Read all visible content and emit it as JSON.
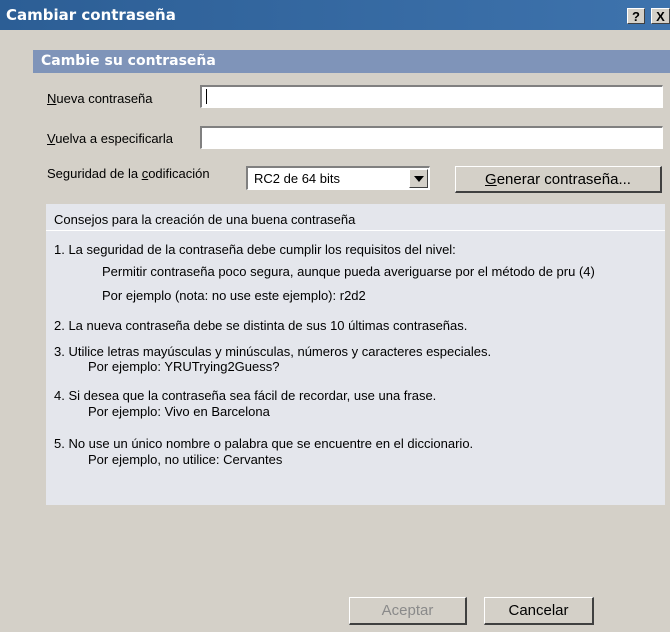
{
  "window": {
    "title": "Cambiar contraseña",
    "help_label": "?",
    "close_label": "X"
  },
  "section": {
    "title": "Cambie su contraseña"
  },
  "form": {
    "new_password": {
      "label_accel": "N",
      "label_rest": "ueva contraseña",
      "value": ""
    },
    "confirm_password": {
      "label_accel": "V",
      "label_rest": "uelva a especificarla",
      "value": ""
    },
    "encryption": {
      "label_pre": "Seguridad de la ",
      "label_accel": "c",
      "label_post": "odificación",
      "selected": "RC2 de 64 bits"
    },
    "generate_button": {
      "accel": "G",
      "rest": "enerar contraseña..."
    }
  },
  "tips": {
    "heading": "Consejos para la creación de una buena contraseña",
    "items": [
      {
        "text": "1.  La seguridad de la contraseña debe cumplir los requisitos del nivel:",
        "sub1": "Permitir contraseña poco segura, aunque pueda averiguarse por el método de pru (4)",
        "sub2": "Por ejemplo (nota: no use este ejemplo):  r2d2"
      },
      {
        "text": "2.  La nueva contraseña debe se distinta de sus 10 últimas contraseñas."
      },
      {
        "text": "3.  Utilice letras mayúsculas y minúsculas, números y caracteres especiales.",
        "sub1": "Por ejemplo:  YRUTrying2Guess?"
      },
      {
        "text": "4.  Si desea que la contraseña sea fácil de recordar, use una frase.",
        "sub1": "Por ejemplo:  Vivo en Barcelona"
      },
      {
        "text": "5.  No use un único nombre o palabra que se encuentre en el diccionario.",
        "sub1": "Por ejemplo, no utilice:  Cervantes"
      }
    ]
  },
  "buttons": {
    "accept": "Aceptar",
    "cancel": "Cancelar"
  }
}
